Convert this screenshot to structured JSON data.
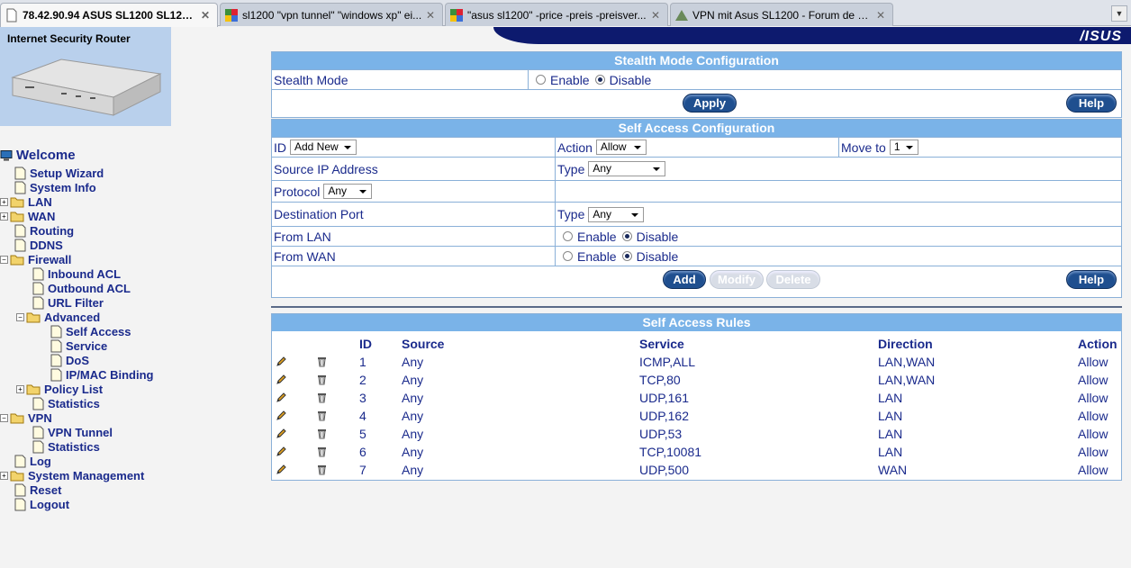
{
  "tabs": [
    {
      "label": "78.42.90.94 ASUS SL1200 SL1200...",
      "active": true
    },
    {
      "label": "sl1200 \"vpn tunnel\" \"windows xp\" ei...",
      "active": false
    },
    {
      "label": "\"asus sl1200\" -price -preis -preisver...",
      "active": false
    },
    {
      "label": "VPN mit Asus SL1200 - Forum de Lu...",
      "active": false
    }
  ],
  "brand": {
    "router_title": "Internet Security Router",
    "logo": "/ISUS"
  },
  "nav": {
    "welcome": "Welcome",
    "setup_wizard": "Setup Wizard",
    "system_info": "System Info",
    "lan": "LAN",
    "wan": "WAN",
    "routing": "Routing",
    "ddns": "DDNS",
    "firewall": "Firewall",
    "inbound_acl": "Inbound ACL",
    "outbound_acl": "Outbound ACL",
    "url_filter": "URL Filter",
    "advanced": "Advanced",
    "self_access": "Self Access",
    "service": "Service",
    "dos": "DoS",
    "ipmac_binding": "IP/MAC Binding",
    "policy_list": "Policy List",
    "fw_statistics": "Statistics",
    "vpn": "VPN",
    "vpn_tunnel": "VPN Tunnel",
    "vpn_statistics": "Statistics",
    "log": "Log",
    "system_management": "System Management",
    "reset": "Reset",
    "logout": "Logout"
  },
  "stealth": {
    "header": "Stealth Mode Configuration",
    "label": "Stealth Mode",
    "enable": "Enable",
    "disable": "Disable",
    "selected": "disable",
    "apply": "Apply",
    "help": "Help"
  },
  "self_access": {
    "header": "Self Access Configuration",
    "id_label": "ID",
    "id_value": "Add New",
    "action_label": "Action",
    "action_value": "Allow",
    "moveto_label": "Move to",
    "moveto_value": "1",
    "source_ip_label": "Source IP Address",
    "type_label": "Type",
    "source_type_value": "Any",
    "protocol_label": "Protocol",
    "protocol_value": "Any",
    "dest_port_label": "Destination Port",
    "dest_type_value": "Any",
    "from_lan_label": "From LAN",
    "from_wan_label": "From WAN",
    "enable": "Enable",
    "disable": "Disable",
    "add": "Add",
    "modify": "Modify",
    "delete": "Delete",
    "help": "Help"
  },
  "rules": {
    "header": "Self Access Rules",
    "columns": {
      "id": "ID",
      "source": "Source",
      "service": "Service",
      "direction": "Direction",
      "action": "Action"
    },
    "rows": [
      {
        "id": "1",
        "source": "Any",
        "service": "ICMP,ALL",
        "direction": "LAN,WAN",
        "action": "Allow"
      },
      {
        "id": "2",
        "source": "Any",
        "service": "TCP,80",
        "direction": "LAN,WAN",
        "action": "Allow"
      },
      {
        "id": "3",
        "source": "Any",
        "service": "UDP,161",
        "direction": "LAN",
        "action": "Allow"
      },
      {
        "id": "4",
        "source": "Any",
        "service": "UDP,162",
        "direction": "LAN",
        "action": "Allow"
      },
      {
        "id": "5",
        "source": "Any",
        "service": "UDP,53",
        "direction": "LAN",
        "action": "Allow"
      },
      {
        "id": "6",
        "source": "Any",
        "service": "TCP,10081",
        "direction": "LAN",
        "action": "Allow"
      },
      {
        "id": "7",
        "source": "Any",
        "service": "UDP,500",
        "direction": "WAN",
        "action": "Allow"
      }
    ]
  },
  "colors": {
    "header": "#7ab3e8",
    "nav_text": "#1a2a8c",
    "banner": "#0d1a6e",
    "button": "#1f4f8f"
  }
}
